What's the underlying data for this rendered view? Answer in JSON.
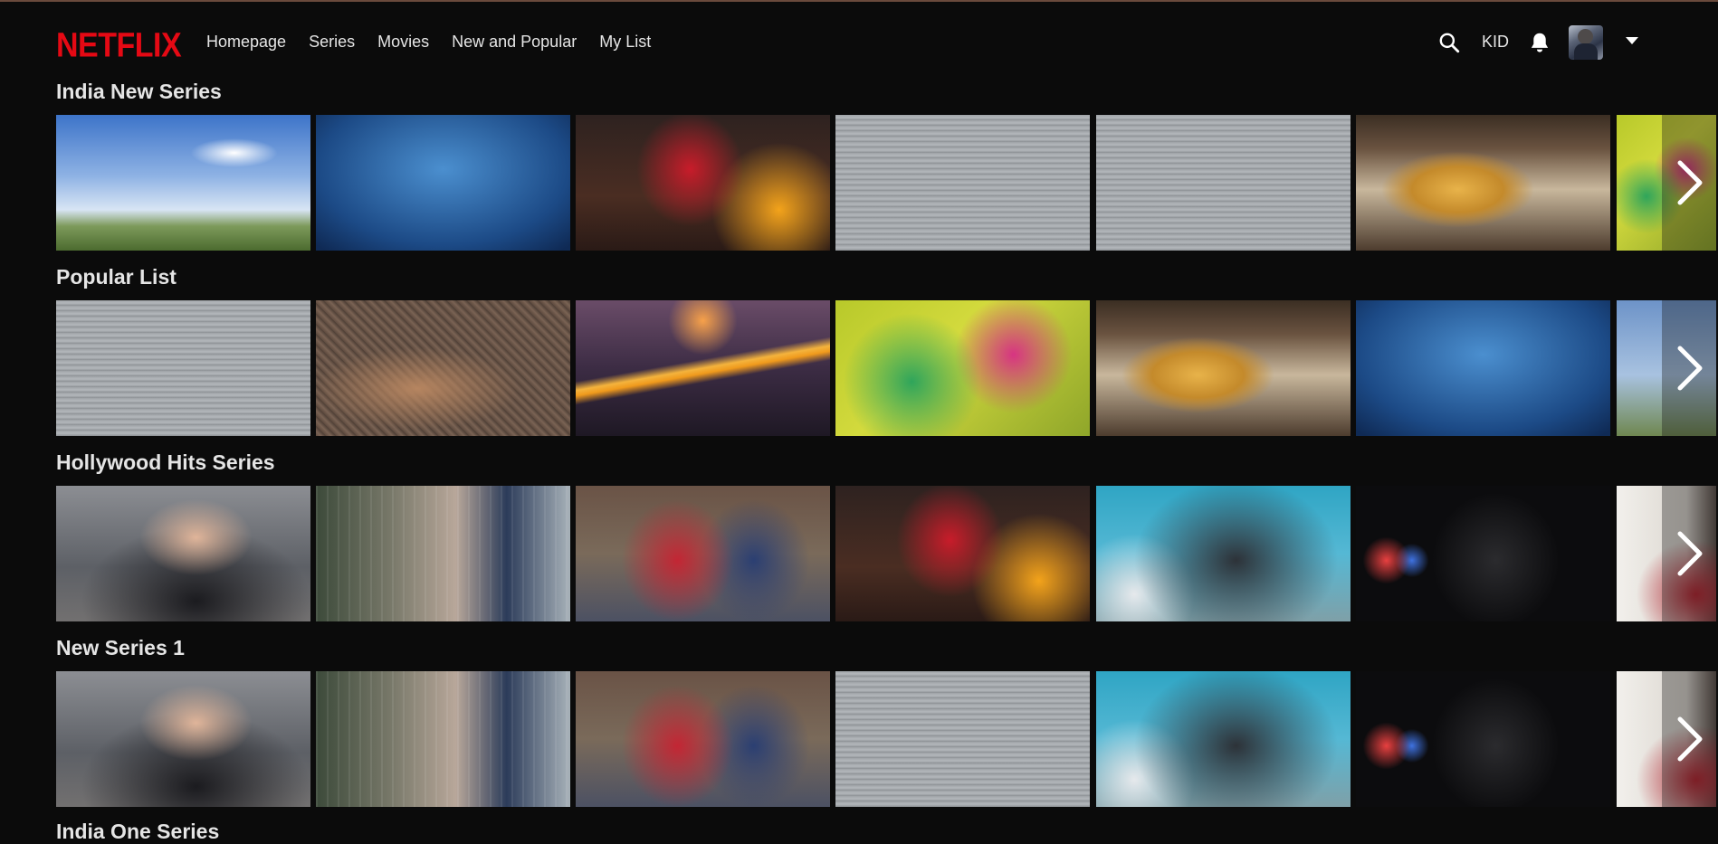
{
  "header": {
    "logo": "NETFLIX",
    "nav": [
      "Homepage",
      "Series",
      "Movies",
      "New and Popular",
      "My List"
    ],
    "kid_label": "KID"
  },
  "colors": {
    "brand": "#e50914",
    "background": "#0b0b0b",
    "text": "#e5e5e5"
  },
  "rows": [
    {
      "title": "India New Series",
      "tiles": [
        "martial-arts",
        "india-gate",
        "wonder-woman",
        "boat-lake",
        "boat-lake",
        "mumbai-train",
        "color-hands"
      ]
    },
    {
      "title": "Popular List",
      "tiles": [
        "boat-lake",
        "city-fort",
        "metro-night",
        "color-hands",
        "mumbai-train",
        "india-gate",
        "martial-arts"
      ]
    },
    {
      "title": "Hollywood Hits Series",
      "tiles": [
        "selfie-woman",
        "skyscrapers",
        "spiderman-captain",
        "wonder-woman",
        "batman-sky",
        "batman-dark",
        "white-wall"
      ]
    },
    {
      "title": "New Series 1",
      "tiles": [
        "selfie-woman",
        "skyscrapers",
        "spiderman-captain",
        "boat-lake",
        "batman-sky",
        "batman-dark",
        "white-wall"
      ]
    }
  ],
  "cut_row": {
    "title": "India One Series"
  },
  "icons": {
    "search": "search-icon",
    "notifications": "bell-icon",
    "profile_menu": "caret-down-icon",
    "row_next": "chevron-right-icon"
  }
}
